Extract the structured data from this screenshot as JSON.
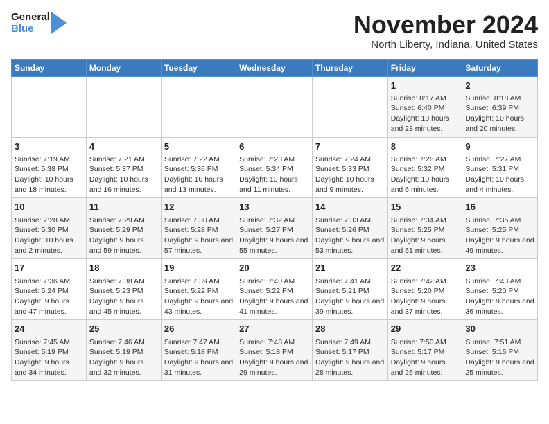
{
  "header": {
    "logo_line1": "General",
    "logo_line2": "Blue",
    "month_year": "November 2024",
    "location": "North Liberty, Indiana, United States"
  },
  "days_of_week": [
    "Sunday",
    "Monday",
    "Tuesday",
    "Wednesday",
    "Thursday",
    "Friday",
    "Saturday"
  ],
  "weeks": [
    [
      {
        "day": "",
        "info": ""
      },
      {
        "day": "",
        "info": ""
      },
      {
        "day": "",
        "info": ""
      },
      {
        "day": "",
        "info": ""
      },
      {
        "day": "",
        "info": ""
      },
      {
        "day": "1",
        "info": "Sunrise: 8:17 AM\nSunset: 6:40 PM\nDaylight: 10 hours and 23 minutes."
      },
      {
        "day": "2",
        "info": "Sunrise: 8:18 AM\nSunset: 6:39 PM\nDaylight: 10 hours and 20 minutes."
      }
    ],
    [
      {
        "day": "3",
        "info": "Sunrise: 7:19 AM\nSunset: 5:38 PM\nDaylight: 10 hours and 18 minutes."
      },
      {
        "day": "4",
        "info": "Sunrise: 7:21 AM\nSunset: 5:37 PM\nDaylight: 10 hours and 16 minutes."
      },
      {
        "day": "5",
        "info": "Sunrise: 7:22 AM\nSunset: 5:36 PM\nDaylight: 10 hours and 13 minutes."
      },
      {
        "day": "6",
        "info": "Sunrise: 7:23 AM\nSunset: 5:34 PM\nDaylight: 10 hours and 11 minutes."
      },
      {
        "day": "7",
        "info": "Sunrise: 7:24 AM\nSunset: 5:33 PM\nDaylight: 10 hours and 9 minutes."
      },
      {
        "day": "8",
        "info": "Sunrise: 7:26 AM\nSunset: 5:32 PM\nDaylight: 10 hours and 6 minutes."
      },
      {
        "day": "9",
        "info": "Sunrise: 7:27 AM\nSunset: 5:31 PM\nDaylight: 10 hours and 4 minutes."
      }
    ],
    [
      {
        "day": "10",
        "info": "Sunrise: 7:28 AM\nSunset: 5:30 PM\nDaylight: 10 hours and 2 minutes."
      },
      {
        "day": "11",
        "info": "Sunrise: 7:29 AM\nSunset: 5:29 PM\nDaylight: 9 hours and 59 minutes."
      },
      {
        "day": "12",
        "info": "Sunrise: 7:30 AM\nSunset: 5:28 PM\nDaylight: 9 hours and 57 minutes."
      },
      {
        "day": "13",
        "info": "Sunrise: 7:32 AM\nSunset: 5:27 PM\nDaylight: 9 hours and 55 minutes."
      },
      {
        "day": "14",
        "info": "Sunrise: 7:33 AM\nSunset: 5:26 PM\nDaylight: 9 hours and 53 minutes."
      },
      {
        "day": "15",
        "info": "Sunrise: 7:34 AM\nSunset: 5:25 PM\nDaylight: 9 hours and 51 minutes."
      },
      {
        "day": "16",
        "info": "Sunrise: 7:35 AM\nSunset: 5:25 PM\nDaylight: 9 hours and 49 minutes."
      }
    ],
    [
      {
        "day": "17",
        "info": "Sunrise: 7:36 AM\nSunset: 5:24 PM\nDaylight: 9 hours and 47 minutes."
      },
      {
        "day": "18",
        "info": "Sunrise: 7:38 AM\nSunset: 5:23 PM\nDaylight: 9 hours and 45 minutes."
      },
      {
        "day": "19",
        "info": "Sunrise: 7:39 AM\nSunset: 5:22 PM\nDaylight: 9 hours and 43 minutes."
      },
      {
        "day": "20",
        "info": "Sunrise: 7:40 AM\nSunset: 5:22 PM\nDaylight: 9 hours and 41 minutes."
      },
      {
        "day": "21",
        "info": "Sunrise: 7:41 AM\nSunset: 5:21 PM\nDaylight: 9 hours and 39 minutes."
      },
      {
        "day": "22",
        "info": "Sunrise: 7:42 AM\nSunset: 5:20 PM\nDaylight: 9 hours and 37 minutes."
      },
      {
        "day": "23",
        "info": "Sunrise: 7:43 AM\nSunset: 5:20 PM\nDaylight: 9 hours and 36 minutes."
      }
    ],
    [
      {
        "day": "24",
        "info": "Sunrise: 7:45 AM\nSunset: 5:19 PM\nDaylight: 9 hours and 34 minutes."
      },
      {
        "day": "25",
        "info": "Sunrise: 7:46 AM\nSunset: 5:19 PM\nDaylight: 9 hours and 32 minutes."
      },
      {
        "day": "26",
        "info": "Sunrise: 7:47 AM\nSunset: 5:18 PM\nDaylight: 9 hours and 31 minutes."
      },
      {
        "day": "27",
        "info": "Sunrise: 7:48 AM\nSunset: 5:18 PM\nDaylight: 9 hours and 29 minutes."
      },
      {
        "day": "28",
        "info": "Sunrise: 7:49 AM\nSunset: 5:17 PM\nDaylight: 9 hours and 28 minutes."
      },
      {
        "day": "29",
        "info": "Sunrise: 7:50 AM\nSunset: 5:17 PM\nDaylight: 9 hours and 26 minutes."
      },
      {
        "day": "30",
        "info": "Sunrise: 7:51 AM\nSunset: 5:16 PM\nDaylight: 9 hours and 25 minutes."
      }
    ]
  ]
}
